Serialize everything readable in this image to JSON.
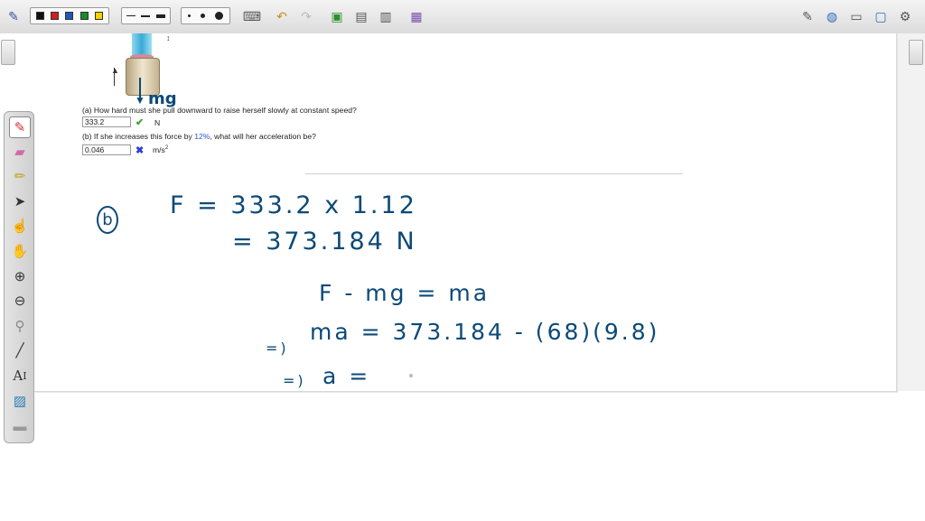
{
  "toolbar": {
    "colors": [
      "#111111",
      "#d11f1f",
      "#1d58b8",
      "#1a8a2a",
      "#f5d000"
    ],
    "line_widths": [
      "thin",
      "medium",
      "thick"
    ],
    "dot_sizes": [
      "small",
      "medium",
      "large"
    ],
    "icons": [
      "keyboard-icon",
      "undo-icon",
      "redo-icon",
      "add-page-icon",
      "page-icon",
      "page-copy-icon",
      "screenshot-icon"
    ],
    "right_icons": [
      "edit-icon",
      "globe-icon",
      "folder-icon",
      "monitor-icon",
      "settings-icon"
    ]
  },
  "palette": {
    "tools": [
      "pen-icon",
      "highlighter-icon",
      "marker-icon",
      "select-arrow-icon",
      "pointer-hand-icon",
      "pan-hand-icon",
      "zoom-in-icon",
      "zoom-out-icon",
      "eyedropper-icon",
      "line-icon",
      "text-icon",
      "image-icon",
      "divider-icon"
    ],
    "text_tool_label": "A"
  },
  "problem": {
    "label_mg": "mg",
    "q_a_prefix": "(a) How hard must she pull downward to raise herself slowly at constant speed?",
    "answer_a": "333.2",
    "unit_a": "N",
    "q_b_pre": "(b) If she increases this force by ",
    "q_b_highlight": "12%",
    "q_b_post": ", what will her acceleration be?",
    "answer_b": "0.046",
    "unit_b": "m/s",
    "unit_b_exp": "2",
    "mark_a": "✔",
    "mark_b": "✖"
  },
  "handwriting": {
    "part_label": "b",
    "line1": "F = 333.2 x 1.12",
    "line2": "= 373.184 N",
    "line3": "F - mg = ma",
    "line4_prefix": "=)",
    "line4": "ma = 373.184 - (68)(9.8)",
    "line5_prefix": "=)",
    "line5": "a ="
  },
  "colors": {
    "ink": "#0c4a78",
    "correct": "#3aa53a",
    "wrong": "#2c3fd0",
    "highlight": "#2f56c5"
  }
}
